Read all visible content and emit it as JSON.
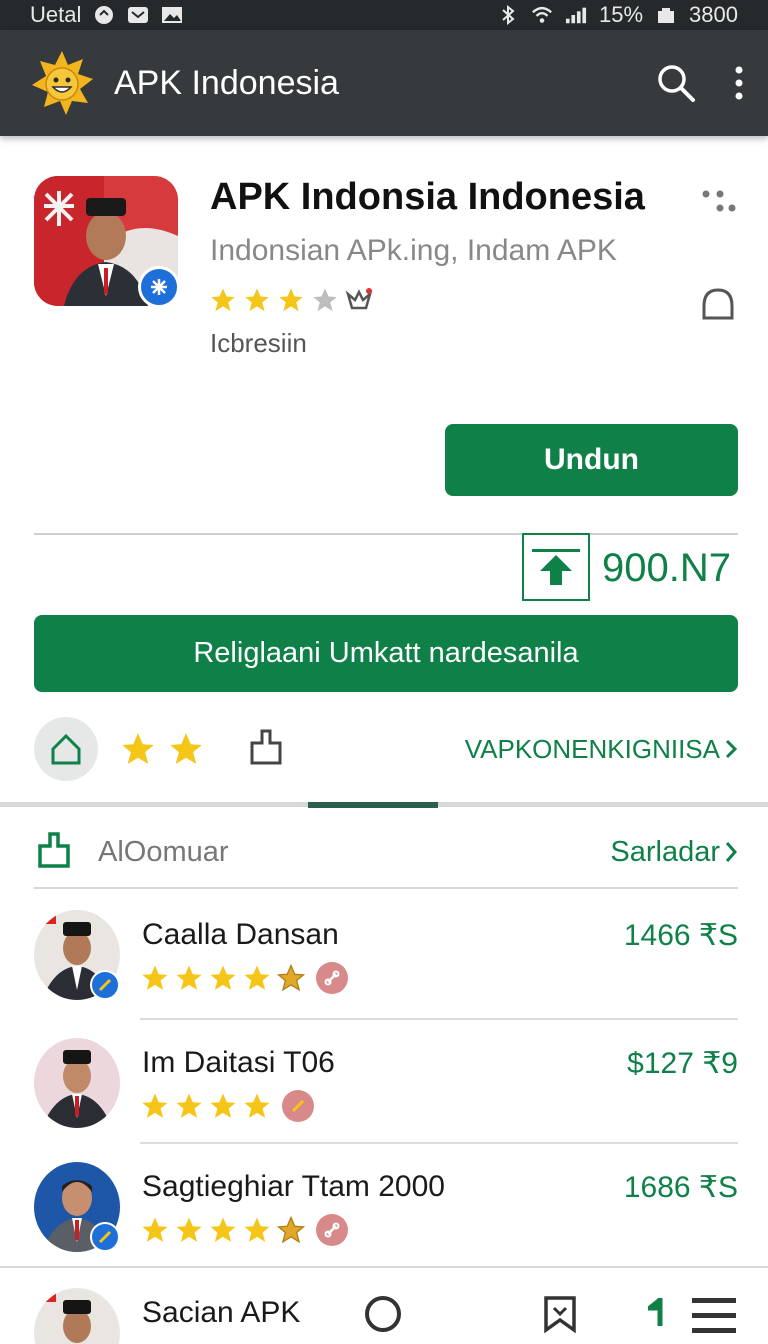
{
  "status_bar": {
    "carrier": "Uetal",
    "battery": "15%",
    "time": "3800"
  },
  "app_bar": {
    "title": "APK Indonesia"
  },
  "app": {
    "name": "APK Indonsia Indonesia",
    "subtitle": "Indonsian APk.ing, Indam APK",
    "developer": "Icbresiin",
    "rating_stars": 3,
    "rating_max": 4,
    "primary_action": "Undun",
    "size": "900.N7",
    "secondary_action": "Religlaani Umkatt nardesanila"
  },
  "action_row": {
    "stars": 2,
    "link": "VAPKONENKIGNIISA"
  },
  "section": {
    "title": "AlOomuar",
    "link": "Sarladar"
  },
  "list": [
    {
      "name": "Caalla Dansan",
      "price": "1466 ₹S",
      "stars": 4.5
    },
    {
      "name": "Im Daitasi T06",
      "price": "$127 ₹9",
      "stars": 4
    },
    {
      "name": "Sagtieghiar Ttam 2000",
      "price": "1686 ₹S",
      "stars": 4.5
    }
  ],
  "bottom_bar": {
    "label": "Sacian APK",
    "sub": ""
  },
  "colors": {
    "accent": "#0f8048",
    "app_bar": "#363a3d",
    "star": "#f5c518"
  }
}
